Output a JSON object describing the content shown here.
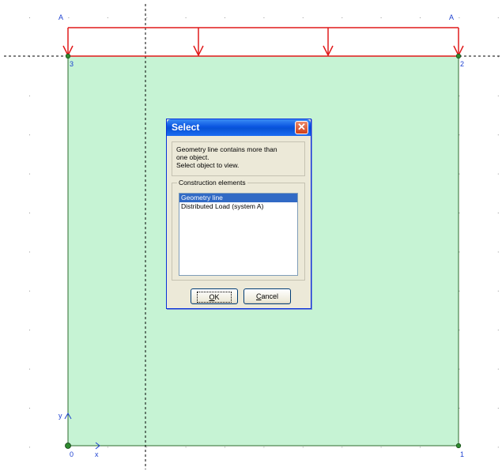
{
  "scene": {
    "fill_color": "#c6f3d4",
    "load_color": "#e01a1a",
    "node_color": "#2f8a2f",
    "guide_color": "#000000",
    "load_system_labels": [
      "A",
      "A"
    ],
    "node_labels": [
      "0",
      "1",
      "2",
      "3"
    ],
    "axis_labels": {
      "x": "x",
      "y": "y"
    }
  },
  "dialog": {
    "title": "Select",
    "message": [
      "Geometry line contains more than",
      "one object.",
      "Select object to view."
    ],
    "group_label": "Construction elements",
    "items": [
      "Geometry line",
      "Distributed Load (system A)"
    ],
    "selected_index": 0,
    "ok_label": "OK",
    "cancel_label": "Cancel"
  }
}
